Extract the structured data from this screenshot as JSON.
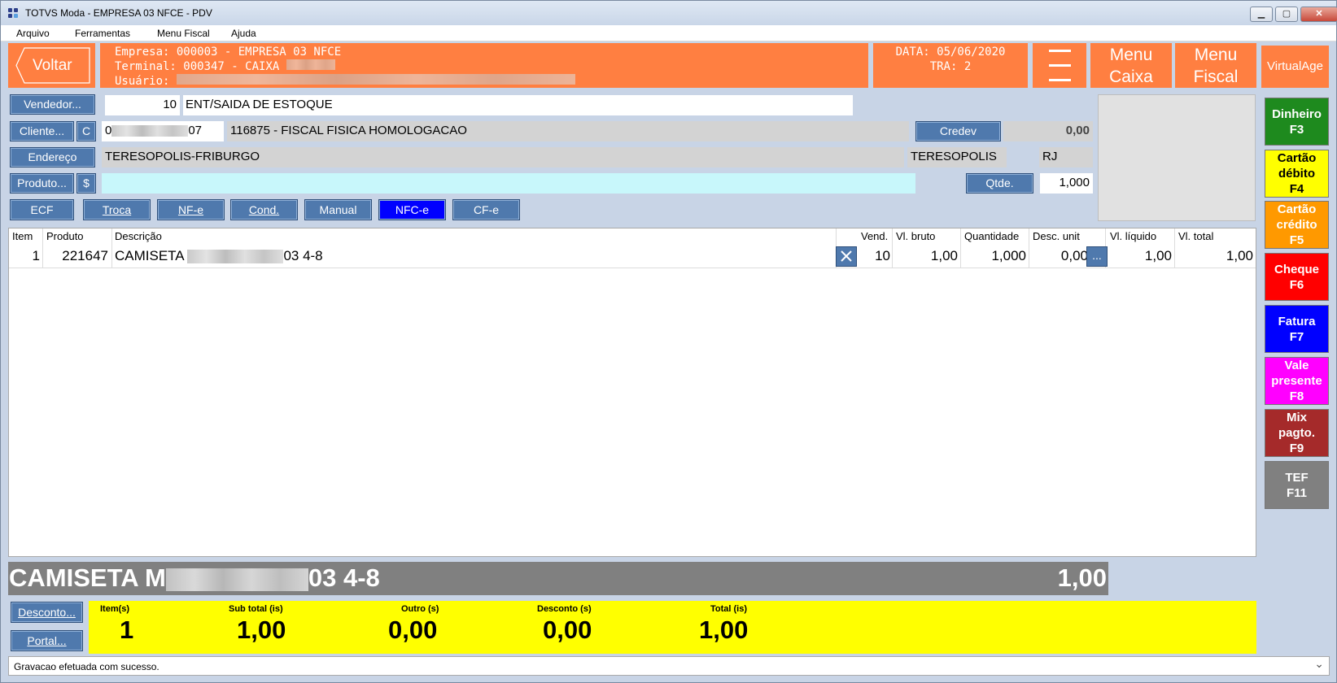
{
  "window": {
    "title": "TOTVS Moda - EMPRESA 03 NFCE - PDV",
    "min_glyph": "▁",
    "max_glyph": "▢",
    "close_glyph": "✕"
  },
  "menu": [
    "Arquivo",
    "Ferramentas",
    "Menu Fiscal",
    "Ajuda"
  ],
  "header": {
    "back_label": "Voltar",
    "empresa": "Empresa: 000003 - EMPRESA 03 NFCE",
    "terminal": "Terminal: 000347 - CAIXA",
    "usuario": "Usuário:",
    "data": "DATA: 05/06/2020",
    "tra": "TRA: 2",
    "menu_caixa": [
      "Menu",
      "Caixa"
    ],
    "menu_fiscal": [
      "Menu",
      "Fiscal"
    ],
    "virtualage": "VirtualAge"
  },
  "form": {
    "vendedor_button": "Vendedor...",
    "vendedor_code": "10",
    "vendedor_name": "ENT/SAIDA DE ESTOQUE",
    "cliente_button": "Cliente...",
    "cliente_c": "C",
    "cliente_code_start": "0",
    "cliente_code_end": "07",
    "cliente_name": "116875 - FISCAL FISICA HOMOLOGACAO",
    "credev_button": "Credev",
    "credev_value": "0,00",
    "endereco_button": "Endereço",
    "endereco": "TERESOPOLIS-FRIBURGO",
    "cidade": "TERESOPOLIS",
    "uf": "RJ",
    "produto_button": "Produto...",
    "produto_dollar": "$",
    "produto_value": "",
    "qtde_button": "Qtde.",
    "qtde_value": "1,000"
  },
  "doc_buttons": [
    "ECF",
    "Troca",
    "NF-e",
    "Cond.",
    "Manual",
    "NFC-e",
    "CF-e"
  ],
  "grid": {
    "headers": [
      "Item",
      "Produto",
      "Descrição",
      "Vend.",
      "Vl. bruto",
      "Quantidade",
      "Desc. unit",
      "Vl. líquido",
      "Vl. total"
    ],
    "rows": [
      {
        "item": "1",
        "produto": "221647",
        "descricao_start": "CAMISETA",
        "descricao_end": "03 4-8",
        "vend": "10",
        "vl_bruto": "1,00",
        "quantidade": "1,000",
        "desc_unit": "0,00",
        "more": "...",
        "vl_liquido": "1,00",
        "vl_total": "1,00"
      }
    ]
  },
  "payments": [
    {
      "label": [
        "Dinheiro",
        "F3"
      ],
      "bg": "#1e8a1e",
      "fg": "#ffffff"
    },
    {
      "label": [
        "Cartão",
        "débito",
        "F4"
      ],
      "bg": "#ffff00",
      "fg": "#000000"
    },
    {
      "label": [
        "Cartão",
        "crédito",
        "F5"
      ],
      "bg": "#ff9900",
      "fg": "#ffffff"
    },
    {
      "label": [
        "Cheque",
        "F6"
      ],
      "bg": "#ff0000",
      "fg": "#ffffff"
    },
    {
      "label": [
        "Fatura",
        "F7"
      ],
      "bg": "#0000ff",
      "fg": "#ffffff"
    },
    {
      "label": [
        "Vale",
        "presente",
        "F8"
      ],
      "bg": "#ff00ff",
      "fg": "#ffffff"
    },
    {
      "label": [
        "Mix",
        "pagto.",
        "F9"
      ],
      "bg": "#a52a2a",
      "fg": "#ffffff"
    },
    {
      "label": [
        "TEF",
        "F11"
      ],
      "bg": "#808080",
      "fg": "#ffffff"
    }
  ],
  "bottom": {
    "desc_start": "CAMISETA M",
    "desc_end": "03 4-8",
    "desc_value": "1,00",
    "desconto_button": "Desconto...",
    "portal_button": "Portal...",
    "totals": [
      {
        "label": "Item(s)",
        "value": "1"
      },
      {
        "label": "Sub total (is)",
        "value": "1,00"
      },
      {
        "label": "Outro (s)",
        "value": "0,00"
      },
      {
        "label": "Desconto (s)",
        "value": "0,00"
      },
      {
        "label": "Total (is)",
        "value": "1,00"
      }
    ]
  },
  "status": {
    "message": "Gravacao efetuada com sucesso.",
    "chevron": "⌄"
  },
  "colors": {
    "header_orange": "#ff7f41",
    "button_blue": "#4f79ad",
    "nfce_active": "#0000ff",
    "totals_yellow": "#ffff00"
  }
}
